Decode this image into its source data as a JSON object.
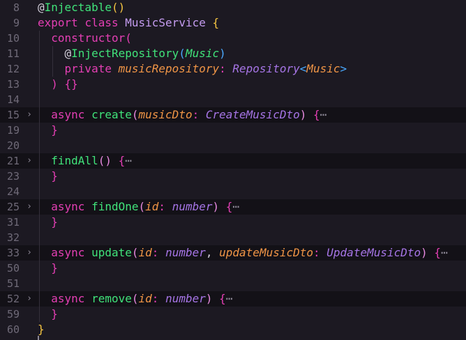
{
  "lines": [
    {
      "num": "8"
    },
    {
      "num": "9"
    },
    {
      "num": "10"
    },
    {
      "num": "11"
    },
    {
      "num": "12"
    },
    {
      "num": "13"
    },
    {
      "num": "14"
    },
    {
      "num": "15"
    },
    {
      "num": "19"
    },
    {
      "num": "20"
    },
    {
      "num": "21"
    },
    {
      "num": "23"
    },
    {
      "num": "24"
    },
    {
      "num": "25"
    },
    {
      "num": "31"
    },
    {
      "num": "32"
    },
    {
      "num": "33"
    },
    {
      "num": "50"
    },
    {
      "num": "51"
    },
    {
      "num": "52"
    },
    {
      "num": "59"
    },
    {
      "num": "60"
    }
  ],
  "tokens": {
    "at": "@",
    "injectable": "Injectable",
    "export": "export",
    "class": "class",
    "class_name": "MusicService",
    "constructor": "constructor",
    "inject_repository": "InjectRepository",
    "music": "Music",
    "private": "private",
    "music_repository": "musicRepository",
    "repository_type": "Repository",
    "async": "async",
    "create": "create",
    "music_dto": "musicDto",
    "create_music_dto": "CreateMusicDto",
    "find_all": "findAll",
    "find_one": "findOne",
    "id": "id",
    "number": "number",
    "update": "update",
    "update_music_dto": "updateMusicDto",
    "update_music_dto_type": "UpdateMusicDto",
    "remove": "remove",
    "fold_ellipsis": "⋯",
    "fold_chevron": "›"
  }
}
